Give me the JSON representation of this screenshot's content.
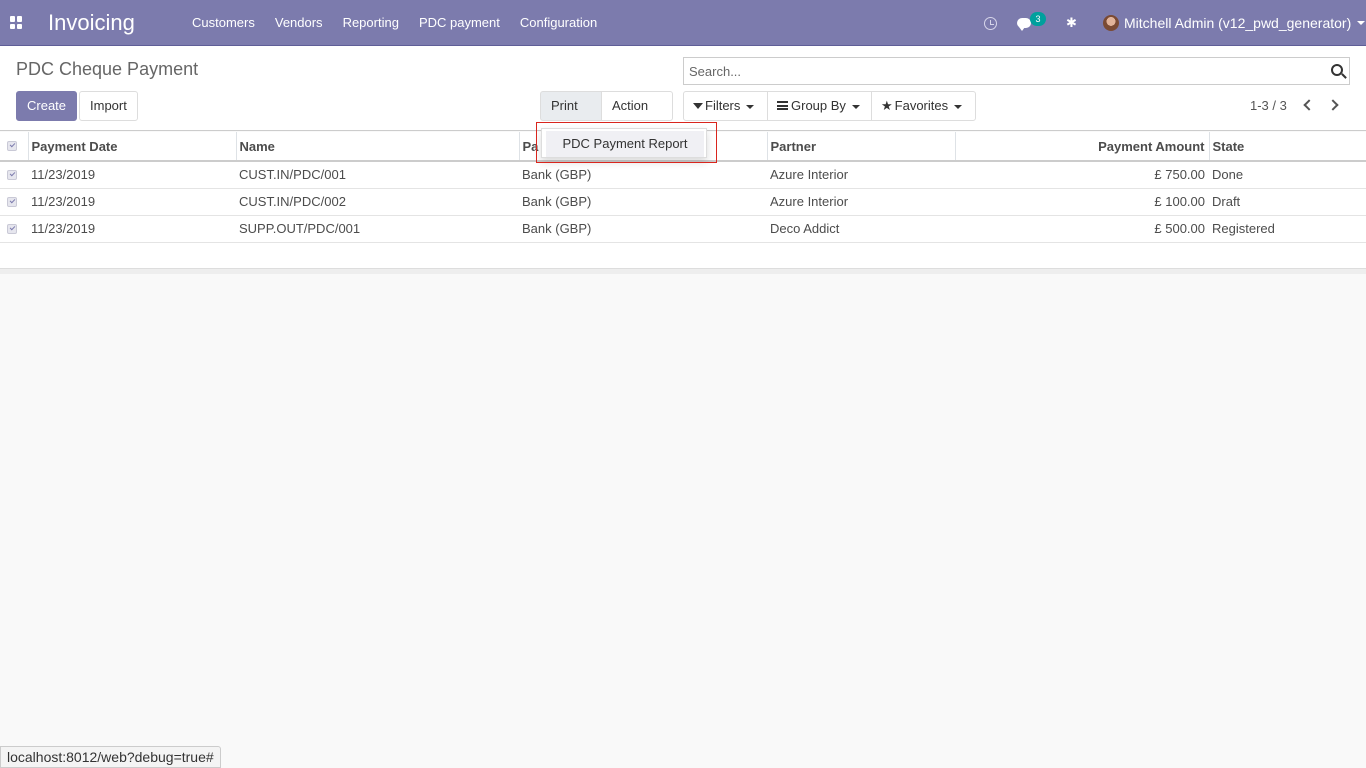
{
  "navbar": {
    "brand": "Invoicing",
    "menu": [
      "Customers",
      "Vendors",
      "Reporting",
      "PDC payment",
      "Configuration"
    ],
    "chat_count": "3",
    "user": "Mitchell Admin (v12_pwd_generator)"
  },
  "control_panel": {
    "title": "PDC Cheque Payment",
    "create_label": "Create",
    "import_label": "Import",
    "print_label": "Print",
    "action_label": "Action",
    "filters_label": "Filters",
    "groupby_label": "Group By",
    "favorites_label": "Favorites",
    "search_placeholder": "Search...",
    "pager": "1-3 / 3"
  },
  "print_menu": {
    "items": [
      "PDC Payment Report"
    ]
  },
  "table": {
    "columns": [
      "Payment Date",
      "Name",
      "Pa",
      "Partner",
      "Payment Amount",
      "State"
    ],
    "rows": [
      {
        "date": "11/23/2019",
        "name": "CUST.IN/PDC/001",
        "journal": "Bank (GBP)",
        "partner": "Azure Interior",
        "amount": "£ 750.00",
        "state": "Done"
      },
      {
        "date": "11/23/2019",
        "name": "CUST.IN/PDC/002",
        "journal": "Bank (GBP)",
        "partner": "Azure Interior",
        "amount": "£ 100.00",
        "state": "Draft"
      },
      {
        "date": "11/23/2019",
        "name": "SUPP.OUT/PDC/001",
        "journal": "Bank (GBP)",
        "partner": "Deco Addict",
        "amount": "£ 500.00",
        "state": "Registered"
      }
    ]
  },
  "status_url": "localhost:8012/web?debug=true#",
  "colors": {
    "brand": "#7c7bad",
    "highlight": "#d9251d"
  }
}
